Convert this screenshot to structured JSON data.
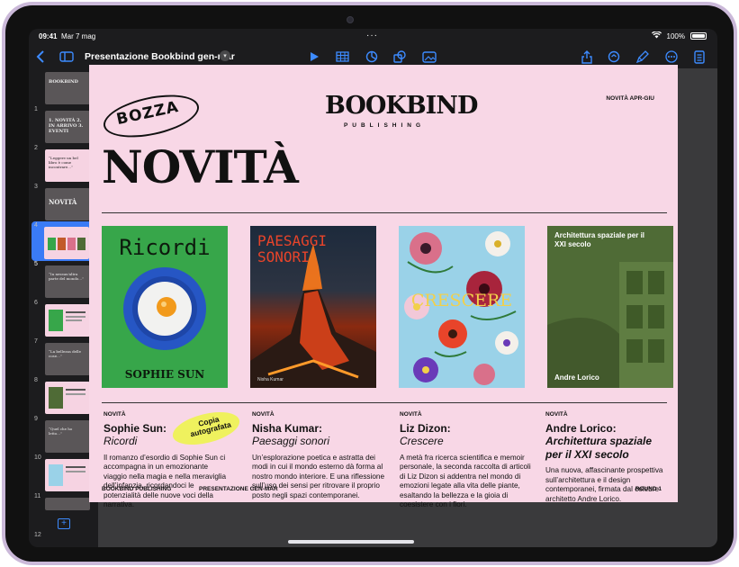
{
  "status": {
    "time": "09:41",
    "date": "Mar 7 mag",
    "battery": "100%"
  },
  "toolbar": {
    "doc_title": "Presentazione Bookbind gen-mar",
    "icons": [
      "back-icon",
      "sidebar-icon",
      "play-icon",
      "table-icon",
      "chart-icon",
      "shapes-icon",
      "media-icon",
      "share-icon",
      "collaborate-icon",
      "format-brush-icon",
      "more-icon",
      "document-icon"
    ]
  },
  "sidebar": {
    "slides": [
      {
        "num": "1",
        "text": "BOOKBIND"
      },
      {
        "num": "2",
        "text": "1. NOVITÀ 2. IN ARRIVO 3. EVENTI"
      },
      {
        "num": "3",
        "text": "“Leggere un bel libro è come incontrare...”"
      },
      {
        "num": "4",
        "text": "NOVITÀ"
      },
      {
        "num": "5",
        "text": ""
      },
      {
        "num": "6",
        "text": "“In nessun'altra parte del mondo...”"
      },
      {
        "num": "7",
        "text": ""
      },
      {
        "num": "8",
        "text": "“La bellezza delle cose...”"
      },
      {
        "num": "9",
        "text": ""
      },
      {
        "num": "10",
        "text": "“Quel che ho letto...”"
      },
      {
        "num": "11",
        "text": ""
      },
      {
        "num": "12",
        "text": ""
      }
    ],
    "selected": 4
  },
  "slide": {
    "logo": "BOOKBIND",
    "logo_sub": "PUBLISHING",
    "tag_right": "NOVITÀ APR-GIU",
    "stamp": "BOZZA",
    "headline": "NOVITÀ",
    "covers": [
      {
        "title": "Ricordi",
        "author": "SOPHIE SUN",
        "bg": "#37a64a"
      },
      {
        "title": "PAESAGGI SONORI",
        "author": "Nisha Kumar",
        "bg": "#1a2230"
      },
      {
        "title": "CRESCERE",
        "author": "",
        "bg": "#9ad2e8"
      },
      {
        "title": "Architettura spaziale per il XXI secolo",
        "author": "Andre Lorico",
        "bg": "#4f6b36"
      }
    ],
    "columns": [
      {
        "label": "NOVITÀ",
        "name": "Sophie Sun:",
        "book": "Ricordi",
        "desc": "Il romanzo d’esordio di Sophie Sun ci accompagna in un emozionante viaggio nella magia e nella meraviglia dell’infanzia, ricordandoci le potenzialità delle nuove voci della narrativa."
      },
      {
        "label": "NOVITÀ",
        "name": "Nisha Kumar:",
        "book": "Paesaggi sonori",
        "desc": "Un’esplorazione poetica e astratta dei modi in cui il mondo esterno dà forma al nostro mondo interiore. E una riflessione sull’uso dei sensi per ritrovare il proprio posto negli spazi contemporanei."
      },
      {
        "label": "NOVITÀ",
        "name": "Liz Dizon:",
        "book": "Crescere",
        "desc": "A metà fra ricerca scientifica e memoir personale, la seconda raccolta di articoli di Liz Dizon si addentra nel mondo di emozioni legate alla vita delle piante, esaltando la bellezza e la gioia di coesistere con i fiori."
      },
      {
        "label": "NOVITÀ",
        "name": "Andre Lorico:",
        "book": "Architettura spaziale per il XXI secolo",
        "desc": "Una nuova, affascinante prospettiva sull’architettura e il design contemporanei, firmata dal celebre architetto Andre Lorico."
      }
    ],
    "badge": "Copia autografata",
    "footer_left": "BOOKBIND PUBLISHING",
    "footer_mid": "PRESENTAZIONE GEN-MAR",
    "footer_right": "ROUND 1"
  }
}
